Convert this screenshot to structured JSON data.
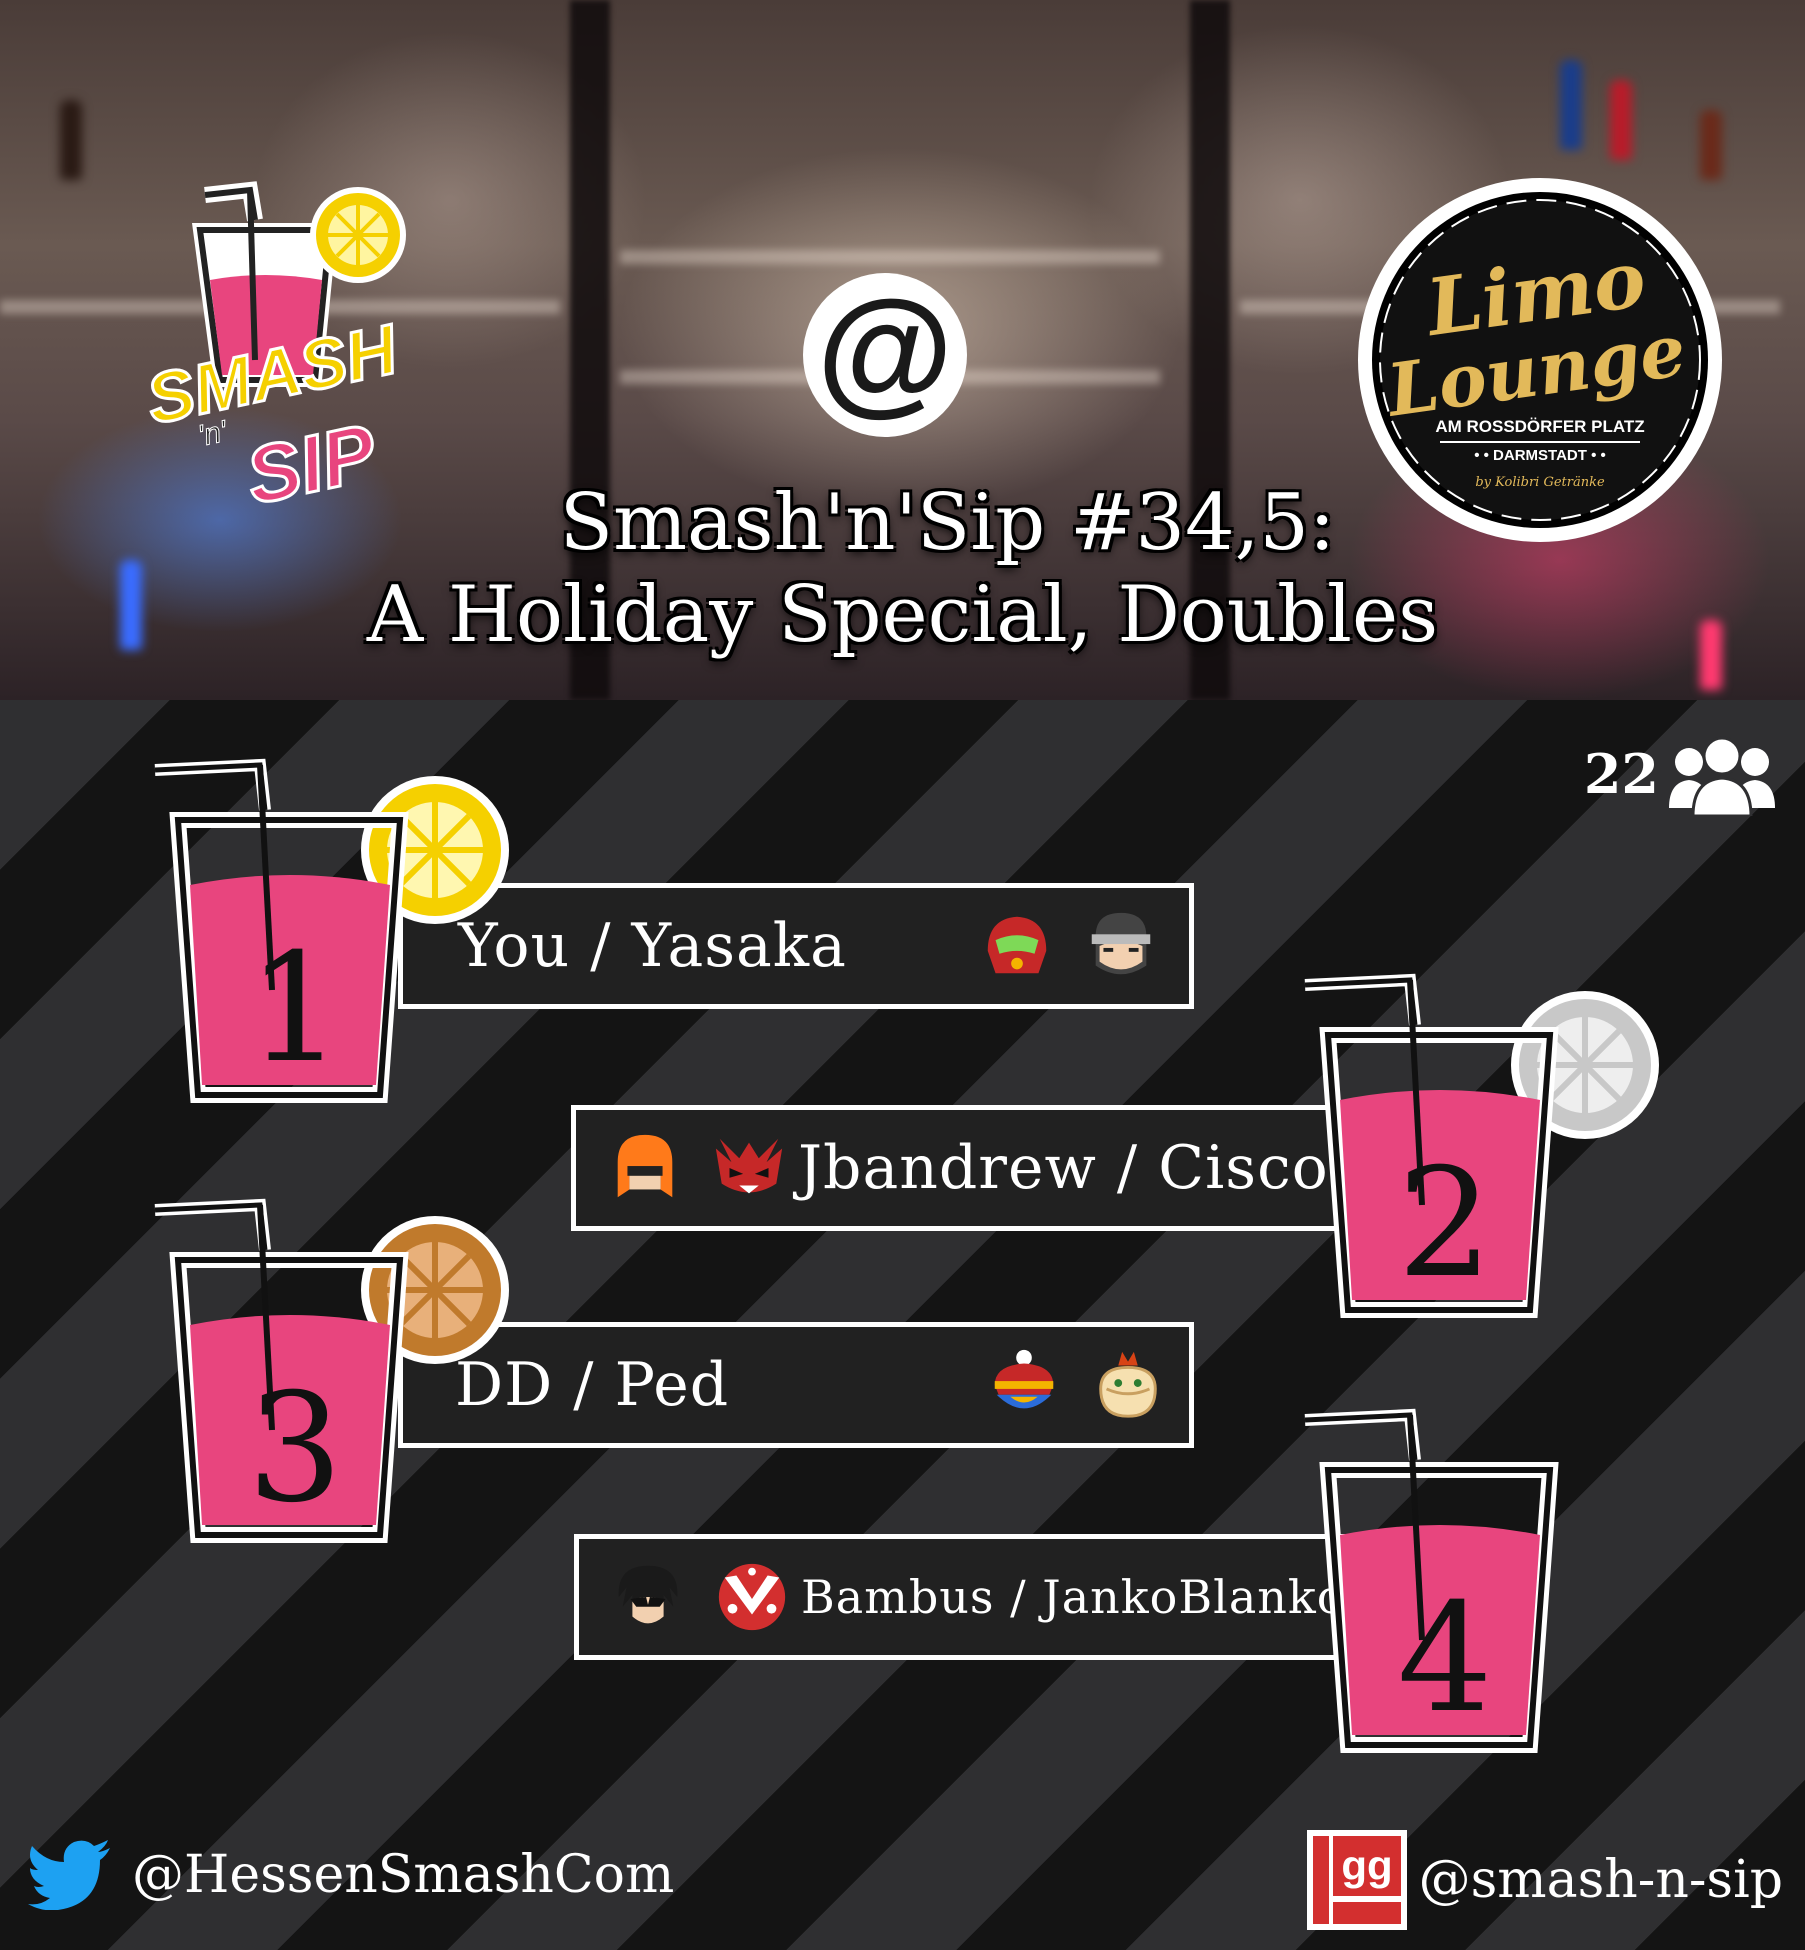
{
  "header": {
    "title_line1": "Smash'n'Sip #34,5:",
    "title_line2": "A Holiday Special, Doubles",
    "at_symbol": "@",
    "logo_left_icon": "smash-n-sip-logo",
    "logo_right_icon": "limo-lounge-logo"
  },
  "entrants": {
    "count": "22",
    "icon": "people-group-icon"
  },
  "placements": [
    {
      "rank": "1",
      "names": "You / Yasaka",
      "medal_color": "#F5D000",
      "characters": [
        "samus-icon",
        "snake-icon"
      ]
    },
    {
      "rank": "2",
      "names": "Jbandrew / Cisco",
      "medal_color": "#C8C8C8",
      "characters": [
        "inkling-icon",
        "incineroar-icon"
      ]
    },
    {
      "rank": "3",
      "names": "DD / Ped",
      "medal_color": "#C07A2C",
      "characters": [
        "king-dedede-icon",
        "bowser-jr-icon"
      ]
    },
    {
      "rank": "4",
      "names": "Bambus / JankoBlanko",
      "medal_color": "none",
      "characters": [
        "joker-icon",
        "piranha-plant-icon"
      ]
    }
  ],
  "footer": {
    "twitter_handle": "@HessenSmashCom",
    "smashgg_handle": "@smash-n-sip",
    "smashgg_icon_text": "gg"
  },
  "colors": {
    "cup_fill": "#E8457E",
    "accent_text": "#FFFFFF",
    "plate_bg": "#212121"
  }
}
